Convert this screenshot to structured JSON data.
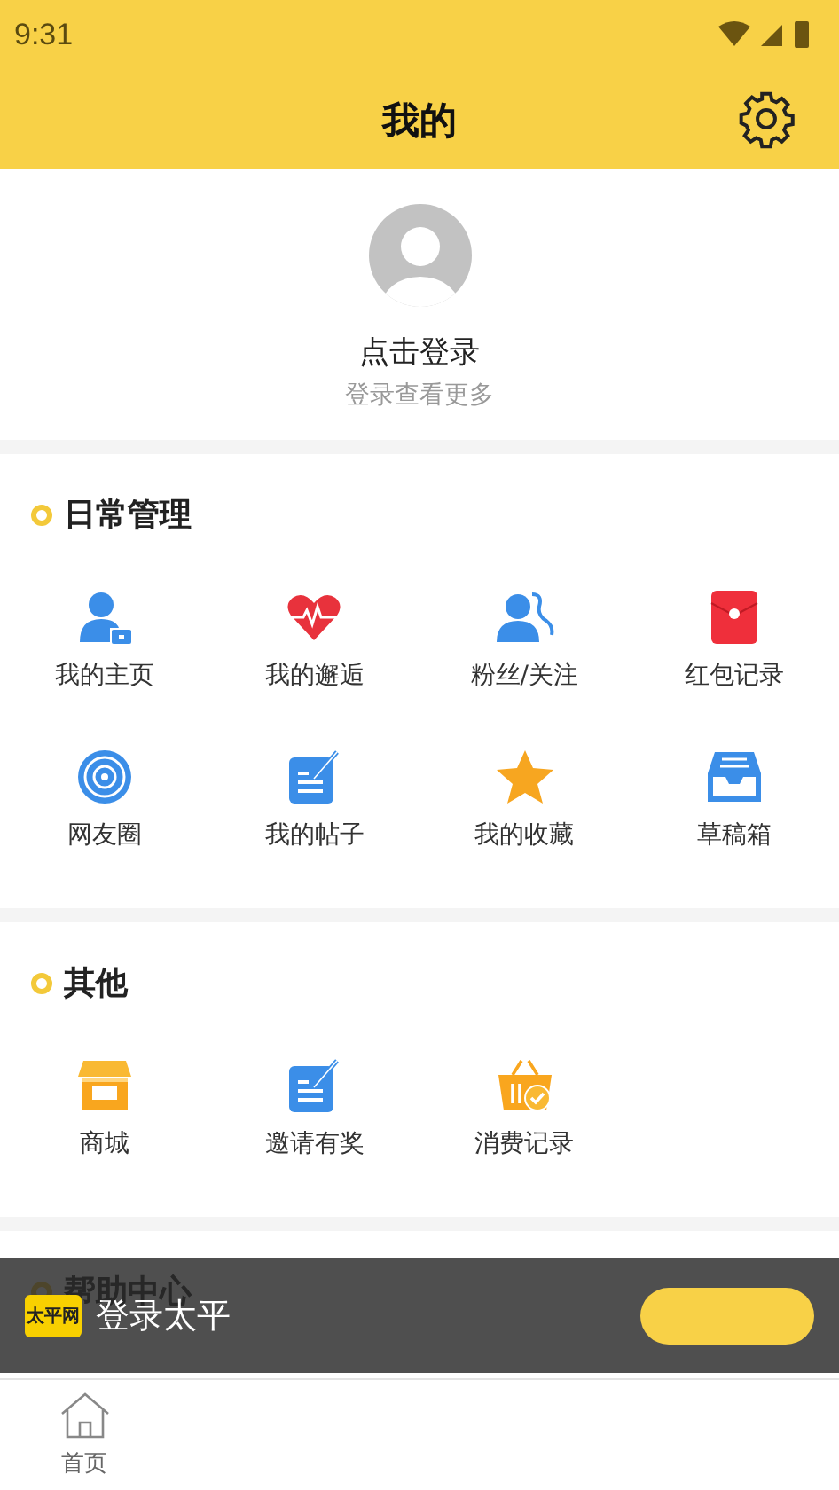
{
  "status_bar": {
    "time": "9:31"
  },
  "header": {
    "title": "我的"
  },
  "profile": {
    "login": "点击登录",
    "hint": "登录查看更多"
  },
  "sections": [
    {
      "title": "日常管理",
      "items": [
        "我的主页",
        "我的邂逅",
        "粉丝/关注",
        "红包记录",
        "网友圈",
        "我的帖子",
        "我的收藏",
        "草稿箱"
      ]
    },
    {
      "title": "其他",
      "items": [
        "商城",
        "邀请有奖",
        "消费记录"
      ]
    },
    {
      "title": "帮助中心"
    }
  ],
  "banner": {
    "logo": "太平网",
    "text": "登录太平"
  },
  "bottom_nav": [
    {
      "label": "首页",
      "selected": false
    }
  ]
}
